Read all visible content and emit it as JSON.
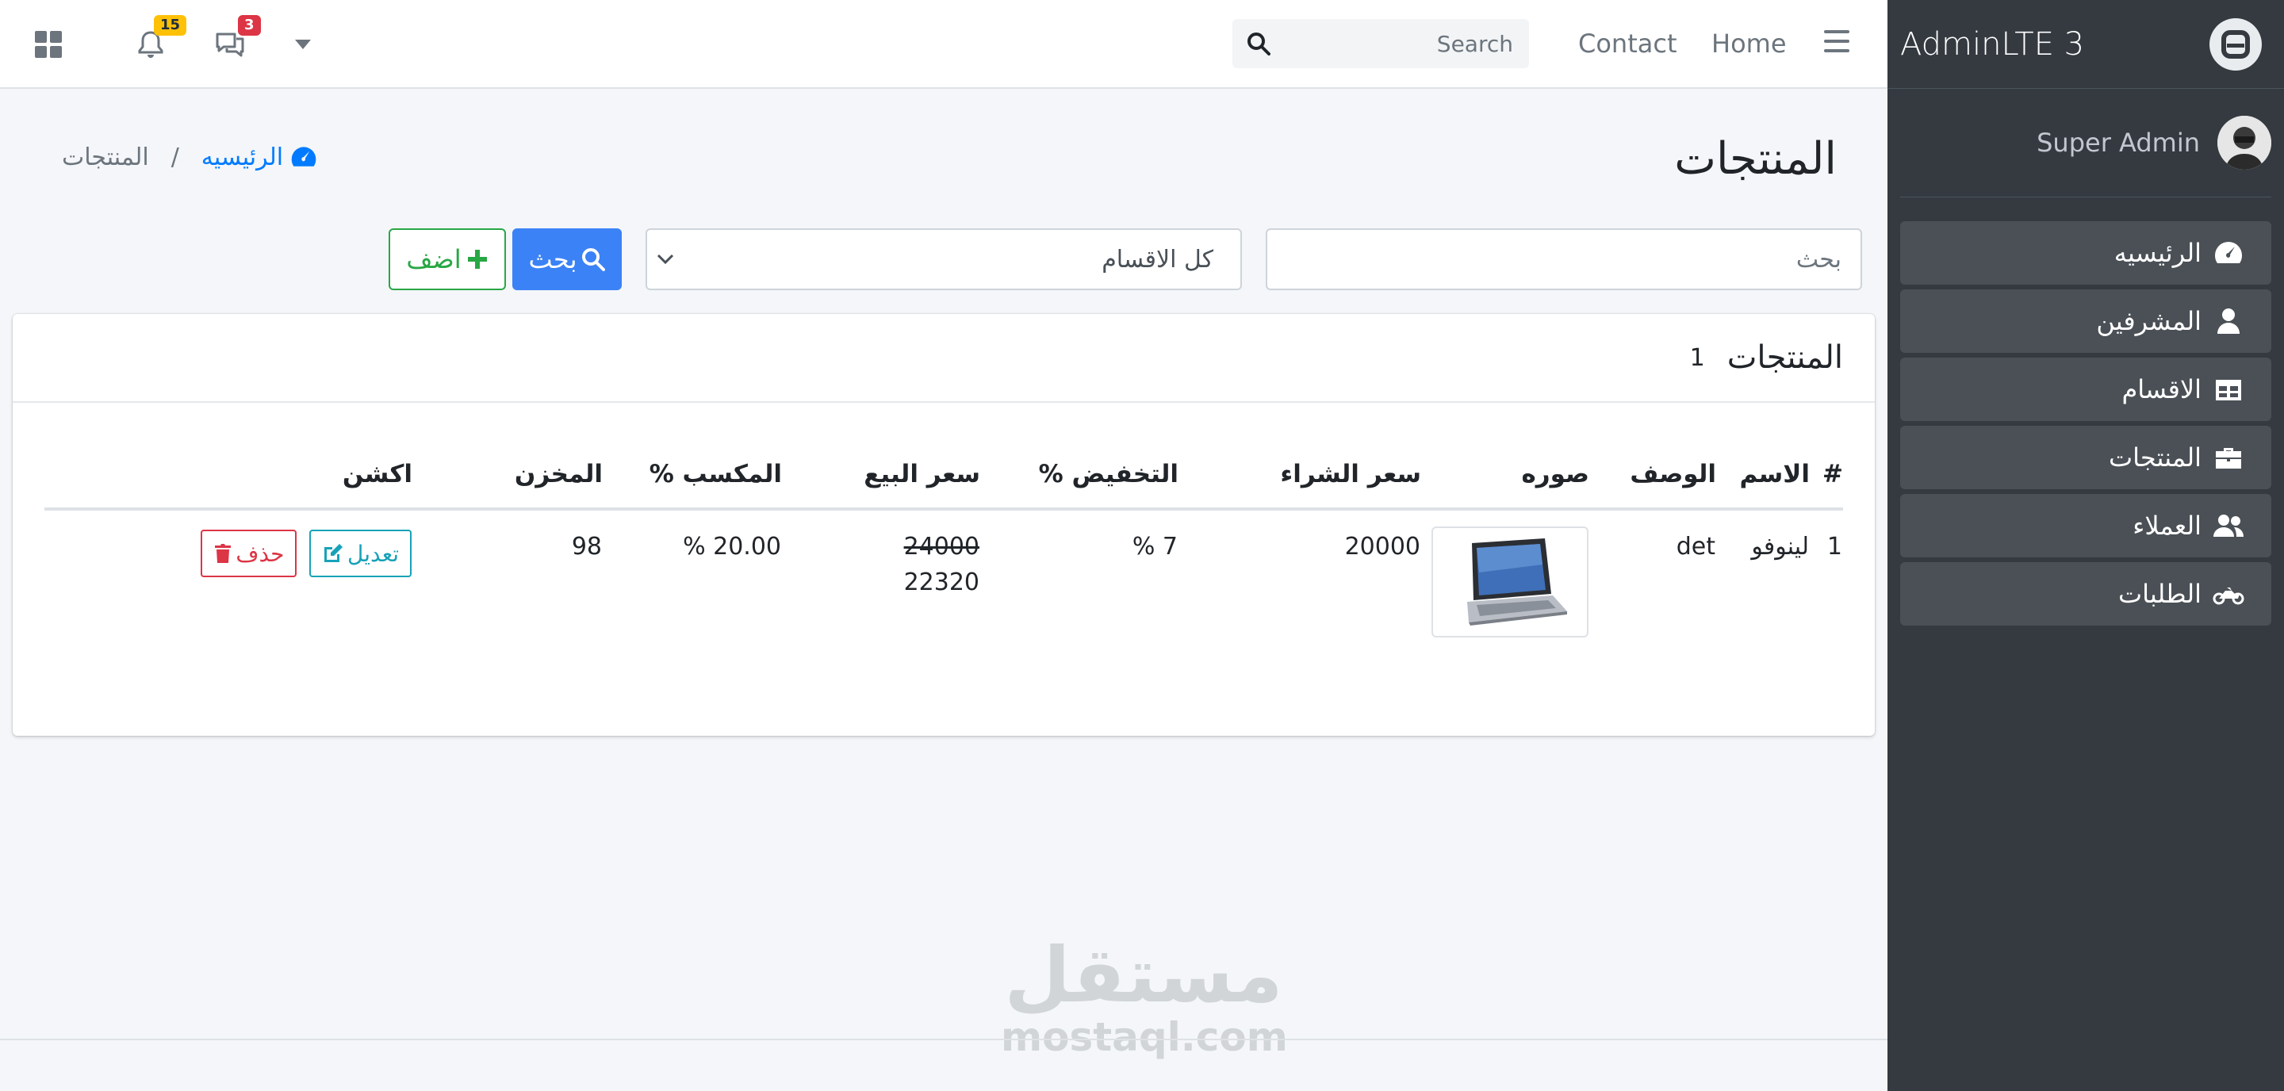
{
  "brand": {
    "title": "AdminLTE 3"
  },
  "user": {
    "name": "Super Admin"
  },
  "sidebar": {
    "items": [
      {
        "label": "الرئيسيه",
        "icon": "tachometer-icon"
      },
      {
        "label": "المشرفين",
        "icon": "user-icon"
      },
      {
        "label": "الاقسام",
        "icon": "table-icon"
      },
      {
        "label": "المنتجات",
        "icon": "briefcase-icon"
      },
      {
        "label": "العملاء",
        "icon": "users-icon"
      },
      {
        "label": "الطلبات",
        "icon": "motorcycle-icon"
      }
    ]
  },
  "navbar": {
    "home": "Home",
    "contact": "Contact",
    "search_placeholder": "Search",
    "notifications_count": "15",
    "messages_count": "3"
  },
  "page": {
    "title": "المنتجات",
    "breadcrumb_home": "الرئيسيه",
    "breadcrumb_sep": "/",
    "breadcrumb_current": "المنتجات"
  },
  "filters": {
    "search_placeholder": "بحث",
    "category_selected": "كل الاقسام",
    "search_button": "بحث",
    "add_button": "اضف"
  },
  "card": {
    "title": "المنتجات",
    "count": "1"
  },
  "table": {
    "headers": [
      "#",
      "الاسم",
      "الوصف",
      "صوره",
      "سعر الشراء",
      "التخفيض %",
      "سعر البيع",
      "المكسب %",
      "المخزن",
      "اكشن"
    ],
    "rows": [
      {
        "index": "1",
        "name": "لينوفو",
        "description": "det",
        "image": "laptop-image",
        "purchase_price": "20000",
        "discount": "7 %",
        "sale_price_old": "24000",
        "sale_price": "22320",
        "profit": "20.00 %",
        "stock": "98",
        "edit_label": "تعديل",
        "delete_label": "حذف"
      }
    ]
  },
  "watermark": {
    "arabic": "مستقل",
    "latin": "mostaql.com"
  }
}
